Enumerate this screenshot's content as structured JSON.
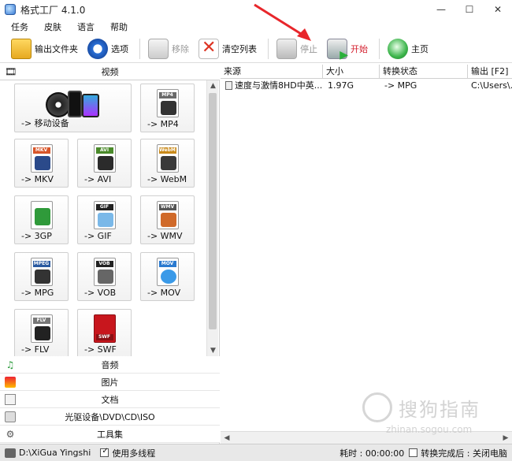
{
  "window": {
    "title": "格式工厂 4.1.0"
  },
  "menu": [
    "任务",
    "皮肤",
    "语言",
    "帮助"
  ],
  "toolbar": {
    "output_folder": "输出文件夹",
    "options": "选项",
    "remove": "移除",
    "clear_list": "清空列表",
    "stop": "停止",
    "start": "开始",
    "home": "主页"
  },
  "categories": {
    "video": "视频",
    "audio": "音频",
    "image": "图片",
    "document": "文档",
    "optical": "光驱设备\\DVD\\CD\\ISO",
    "tools": "工具集"
  },
  "tiles": [
    {
      "label": "-> 移动设备",
      "tag": ""
    },
    {
      "label": "-> MP4",
      "tag": "MP4"
    },
    {
      "label": "-> MKV",
      "tag": "MKV"
    },
    {
      "label": "-> AVI",
      "tag": "AVI"
    },
    {
      "label": "-> WebM",
      "tag": "WebM"
    },
    {
      "label": "-> 3GP",
      "tag": ""
    },
    {
      "label": "-> GIF",
      "tag": "GIF"
    },
    {
      "label": "-> WMV",
      "tag": "WMV"
    },
    {
      "label": "-> MPG",
      "tag": "MPEG"
    },
    {
      "label": "-> VOB",
      "tag": "VOB"
    },
    {
      "label": "-> MOV",
      "tag": "MOV"
    },
    {
      "label": "-> FLV",
      "tag": "FLV"
    },
    {
      "label": "-> SWF",
      "tag": "SWF"
    }
  ],
  "file_list": {
    "columns": [
      "来源",
      "大小",
      "转换状态",
      "输出 [F2]"
    ],
    "rows": [
      {
        "source": "速度与激情8HD中英...",
        "size": "1.97G",
        "status": "-> MPG",
        "output": "C:\\Users\\..."
      }
    ]
  },
  "status": {
    "path": "D:\\XiGua Yingshi",
    "multithread": "使用多线程",
    "elapsed": "耗时 : 00:00:00",
    "after_convert": "转换完成后 : 关闭电脑"
  },
  "watermark": {
    "text": "搜狗指南",
    "url": "zhinan.sogou.com"
  },
  "colors": {
    "accent_red": "#d4202f",
    "start_green": "#2ab03a"
  }
}
